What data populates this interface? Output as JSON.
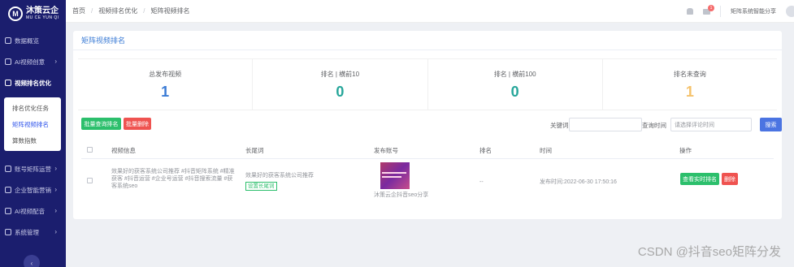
{
  "brand": {
    "name": "沐策云企",
    "sub": "MU CE YUN QI"
  },
  "sidebar": {
    "items": [
      {
        "label": "数据概览",
        "chevron": ""
      },
      {
        "label": "AI视频创意",
        "chevron": "›"
      },
      {
        "label": "视频排名优化",
        "chevron": "⌄"
      },
      {
        "label": "账号矩阵运营",
        "chevron": "›"
      },
      {
        "label": "企业智能营销",
        "chevron": "›"
      },
      {
        "label": "AI视频配音",
        "chevron": "›"
      },
      {
        "label": "系统管理",
        "chevron": "›"
      }
    ],
    "submenu": [
      "排名优化任务",
      "矩阵视频排名",
      "算数指数"
    ],
    "collapse": "‹"
  },
  "header": {
    "breadcrumb": [
      "首页",
      "视频排名优化",
      "矩阵视频排名"
    ],
    "separator": "/",
    "badge": "1",
    "user": "矩阵系统智能分享"
  },
  "card": {
    "title": "矩阵视频排名",
    "stats": [
      {
        "label": "总发布视频",
        "value": "1",
        "color": "#3a7bd5"
      },
      {
        "label": "排名 | 横前10",
        "value": "0",
        "color": "#26a69a"
      },
      {
        "label": "排名 | 横前100",
        "value": "0",
        "color": "#26a69a"
      },
      {
        "label": "排名未查询",
        "value": "1",
        "color": "#f5c26b"
      }
    ]
  },
  "toolbar": {
    "batch_query": "批量查询排名",
    "batch_delete": "批量删除",
    "keyword_label": "关键词",
    "time_label": "查询时间",
    "time_placeholder": "请选择评论时间",
    "search": "搜索"
  },
  "table": {
    "headers": [
      "视频信息",
      "长尾词",
      "发布账号",
      "排名",
      "时间",
      "操作"
    ],
    "rows": [
      {
        "video_info": "效果好的获客系统公司推荐 #抖音矩阵系统 #精准获客 #抖音运营 #企业号运营 #抖音搜索流量 #获客系统seo",
        "keyword": "效果好的获客系统公司推荐",
        "keyword_tag": "设置长尾词",
        "account": "沐策云企抖音seo分享",
        "rank": "--",
        "time": "发布时间:2022-06-30 17:50:16",
        "action_query": "查看实时排名",
        "action_delete": "删除"
      }
    ]
  },
  "watermark": "CSDN @抖音seo矩阵分发"
}
